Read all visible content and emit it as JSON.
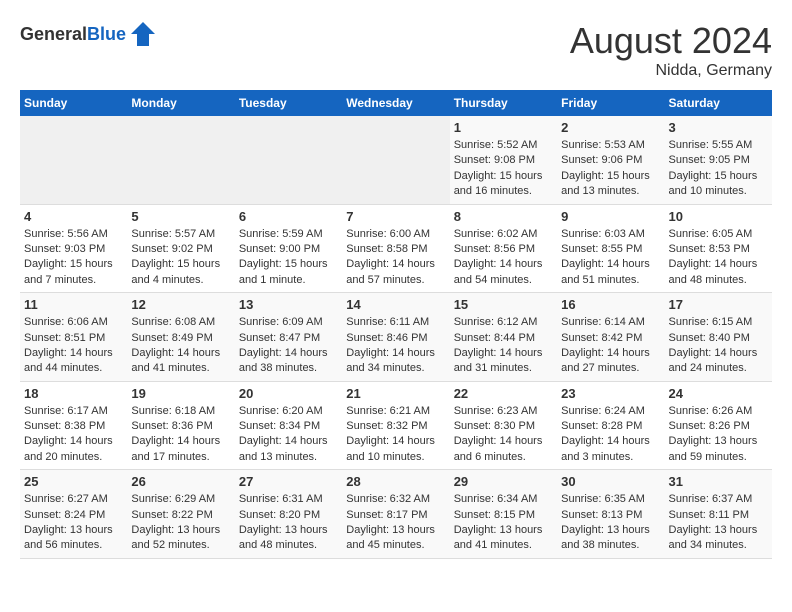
{
  "header": {
    "logo_general": "General",
    "logo_blue": "Blue",
    "title": "August 2024",
    "subtitle": "Nidda, Germany"
  },
  "days_of_week": [
    "Sunday",
    "Monday",
    "Tuesday",
    "Wednesday",
    "Thursday",
    "Friday",
    "Saturday"
  ],
  "weeks": [
    {
      "days": [
        {
          "number": "",
          "info": ""
        },
        {
          "number": "",
          "info": ""
        },
        {
          "number": "",
          "info": ""
        },
        {
          "number": "",
          "info": ""
        },
        {
          "number": "1",
          "info": "Sunrise: 5:52 AM\nSunset: 9:08 PM\nDaylight: 15 hours and 16 minutes."
        },
        {
          "number": "2",
          "info": "Sunrise: 5:53 AM\nSunset: 9:06 PM\nDaylight: 15 hours and 13 minutes."
        },
        {
          "number": "3",
          "info": "Sunrise: 5:55 AM\nSunset: 9:05 PM\nDaylight: 15 hours and 10 minutes."
        }
      ]
    },
    {
      "days": [
        {
          "number": "4",
          "info": "Sunrise: 5:56 AM\nSunset: 9:03 PM\nDaylight: 15 hours and 7 minutes."
        },
        {
          "number": "5",
          "info": "Sunrise: 5:57 AM\nSunset: 9:02 PM\nDaylight: 15 hours and 4 minutes."
        },
        {
          "number": "6",
          "info": "Sunrise: 5:59 AM\nSunset: 9:00 PM\nDaylight: 15 hours and 1 minute."
        },
        {
          "number": "7",
          "info": "Sunrise: 6:00 AM\nSunset: 8:58 PM\nDaylight: 14 hours and 57 minutes."
        },
        {
          "number": "8",
          "info": "Sunrise: 6:02 AM\nSunset: 8:56 PM\nDaylight: 14 hours and 54 minutes."
        },
        {
          "number": "9",
          "info": "Sunrise: 6:03 AM\nSunset: 8:55 PM\nDaylight: 14 hours and 51 minutes."
        },
        {
          "number": "10",
          "info": "Sunrise: 6:05 AM\nSunset: 8:53 PM\nDaylight: 14 hours and 48 minutes."
        }
      ]
    },
    {
      "days": [
        {
          "number": "11",
          "info": "Sunrise: 6:06 AM\nSunset: 8:51 PM\nDaylight: 14 hours and 44 minutes."
        },
        {
          "number": "12",
          "info": "Sunrise: 6:08 AM\nSunset: 8:49 PM\nDaylight: 14 hours and 41 minutes."
        },
        {
          "number": "13",
          "info": "Sunrise: 6:09 AM\nSunset: 8:47 PM\nDaylight: 14 hours and 38 minutes."
        },
        {
          "number": "14",
          "info": "Sunrise: 6:11 AM\nSunset: 8:46 PM\nDaylight: 14 hours and 34 minutes."
        },
        {
          "number": "15",
          "info": "Sunrise: 6:12 AM\nSunset: 8:44 PM\nDaylight: 14 hours and 31 minutes."
        },
        {
          "number": "16",
          "info": "Sunrise: 6:14 AM\nSunset: 8:42 PM\nDaylight: 14 hours and 27 minutes."
        },
        {
          "number": "17",
          "info": "Sunrise: 6:15 AM\nSunset: 8:40 PM\nDaylight: 14 hours and 24 minutes."
        }
      ]
    },
    {
      "days": [
        {
          "number": "18",
          "info": "Sunrise: 6:17 AM\nSunset: 8:38 PM\nDaylight: 14 hours and 20 minutes."
        },
        {
          "number": "19",
          "info": "Sunrise: 6:18 AM\nSunset: 8:36 PM\nDaylight: 14 hours and 17 minutes."
        },
        {
          "number": "20",
          "info": "Sunrise: 6:20 AM\nSunset: 8:34 PM\nDaylight: 14 hours and 13 minutes."
        },
        {
          "number": "21",
          "info": "Sunrise: 6:21 AM\nSunset: 8:32 PM\nDaylight: 14 hours and 10 minutes."
        },
        {
          "number": "22",
          "info": "Sunrise: 6:23 AM\nSunset: 8:30 PM\nDaylight: 14 hours and 6 minutes."
        },
        {
          "number": "23",
          "info": "Sunrise: 6:24 AM\nSunset: 8:28 PM\nDaylight: 14 hours and 3 minutes."
        },
        {
          "number": "24",
          "info": "Sunrise: 6:26 AM\nSunset: 8:26 PM\nDaylight: 13 hours and 59 minutes."
        }
      ]
    },
    {
      "days": [
        {
          "number": "25",
          "info": "Sunrise: 6:27 AM\nSunset: 8:24 PM\nDaylight: 13 hours and 56 minutes."
        },
        {
          "number": "26",
          "info": "Sunrise: 6:29 AM\nSunset: 8:22 PM\nDaylight: 13 hours and 52 minutes."
        },
        {
          "number": "27",
          "info": "Sunrise: 6:31 AM\nSunset: 8:20 PM\nDaylight: 13 hours and 48 minutes."
        },
        {
          "number": "28",
          "info": "Sunrise: 6:32 AM\nSunset: 8:17 PM\nDaylight: 13 hours and 45 minutes."
        },
        {
          "number": "29",
          "info": "Sunrise: 6:34 AM\nSunset: 8:15 PM\nDaylight: 13 hours and 41 minutes."
        },
        {
          "number": "30",
          "info": "Sunrise: 6:35 AM\nSunset: 8:13 PM\nDaylight: 13 hours and 38 minutes."
        },
        {
          "number": "31",
          "info": "Sunrise: 6:37 AM\nSunset: 8:11 PM\nDaylight: 13 hours and 34 minutes."
        }
      ]
    }
  ]
}
